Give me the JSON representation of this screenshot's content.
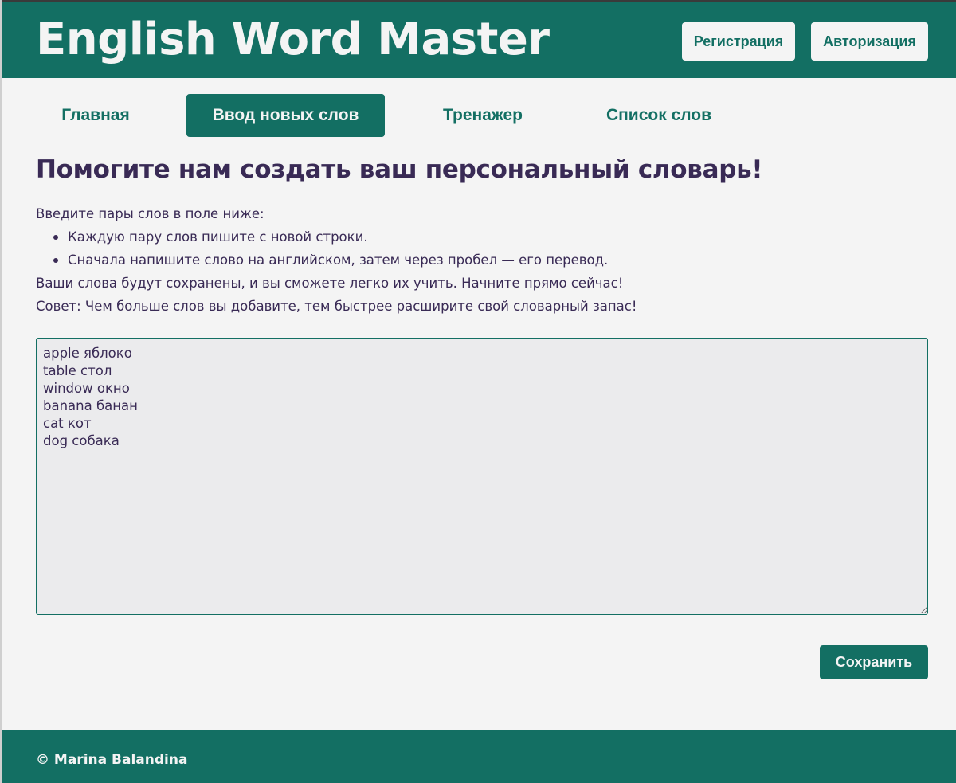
{
  "header": {
    "title": "English Word Master",
    "register_label": "Регистрация",
    "login_label": "Авторизация"
  },
  "nav": {
    "items": [
      {
        "label": "Главная",
        "active": false
      },
      {
        "label": "Ввод новых слов",
        "active": true
      },
      {
        "label": "Тренажер",
        "active": false
      },
      {
        "label": "Список слов",
        "active": false
      }
    ]
  },
  "main": {
    "heading": "Помогите нам создать ваш персональный словарь!",
    "intro": "Введите пары слов в поле ниже:",
    "bullets": [
      "Каждую пару слов пишите с новой строки.",
      "Сначала напишите слово на английском, затем через пробел — его перевод."
    ],
    "note": "Ваши слова будут сохранены, и вы сможете легко их учить. Начните прямо сейчас!",
    "tip": "Совет: Чем больше слов вы добавите, тем быстрее расширите свой словарный запас!",
    "words_value": "apple яблоко\ntable стол\nwindow окно\nbanana банан\ncat кот\ndog собака",
    "save_label": "Сохранить"
  },
  "footer": {
    "copyright": "© Marina Balandina"
  },
  "colors": {
    "brand": "#136f63",
    "text": "#392a55",
    "background": "#f4f4f4",
    "textarea_bg": "#ebebed"
  }
}
